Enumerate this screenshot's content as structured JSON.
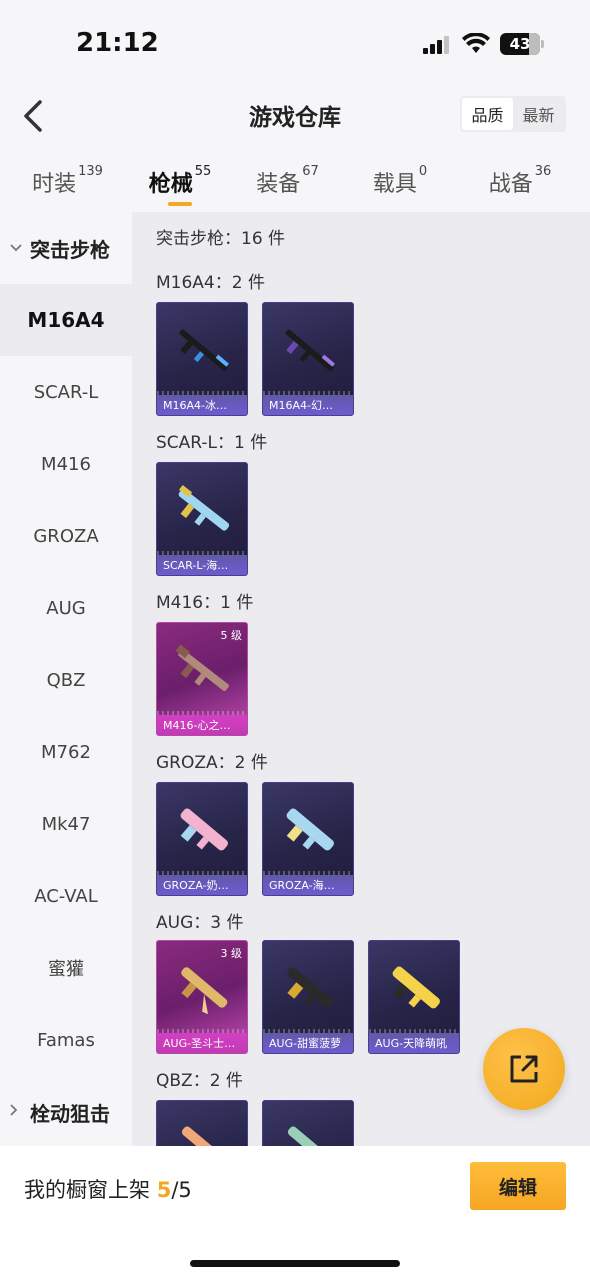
{
  "status": {
    "time": "21:12",
    "battery": "43"
  },
  "header": {
    "title": "游戏仓库",
    "sort_options": [
      "品质",
      "最新"
    ]
  },
  "tabs": [
    {
      "label": "时装",
      "count": "139"
    },
    {
      "label": "枪械",
      "count": "55"
    },
    {
      "label": "装备",
      "count": "67"
    },
    {
      "label": "载具",
      "count": "0"
    },
    {
      "label": "战备",
      "count": "36"
    }
  ],
  "sidebar": {
    "group_open": "突击步枪",
    "items": [
      "M16A4",
      "SCAR-L",
      "M416",
      "GROZA",
      "AUG",
      "QBZ",
      "M762",
      "Mk47",
      "AC-VAL",
      "蜜獾",
      "Famas"
    ],
    "group_closed": "栓动狙击"
  },
  "main": {
    "header": "突击步枪：16 件",
    "sections": [
      {
        "title": "M16A4：2 件",
        "cards": [
          {
            "label": "M16A4-冰…"
          },
          {
            "label": "M16A4-幻…"
          }
        ]
      },
      {
        "title": "SCAR-L：1 件",
        "cards": [
          {
            "label": "SCAR-L-海…"
          }
        ]
      },
      {
        "title": "M416：1 件",
        "cards": [
          {
            "label": "M416-心之…",
            "level": "5 级"
          }
        ]
      },
      {
        "title": "GROZA：2 件",
        "cards": [
          {
            "label": "GROZA-奶…"
          },
          {
            "label": "GROZA-海…"
          }
        ]
      },
      {
        "title": "AUG：3 件",
        "cards": [
          {
            "label": "AUG-圣斗士…",
            "level": "3 级"
          },
          {
            "label": "AUG-甜蜜菠萝"
          },
          {
            "label": "AUG-天降萌吼"
          }
        ]
      },
      {
        "title": "QBZ：2 件",
        "cards": [
          {
            "label": ""
          },
          {
            "label": ""
          }
        ]
      }
    ]
  },
  "bottom": {
    "shelf_label": "我的橱窗上架 ",
    "shelf_current": "5",
    "shelf_total": "/5",
    "edit_label": "编辑"
  },
  "colors": {
    "accent": "#f5a623",
    "card_purple": "#2a2750",
    "card_pink": "#8a2b7e"
  }
}
